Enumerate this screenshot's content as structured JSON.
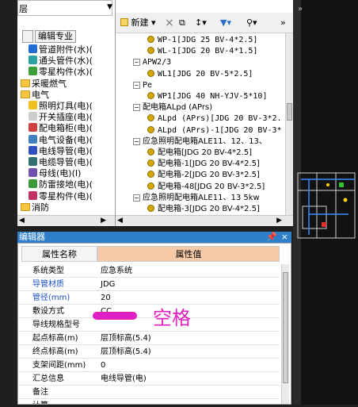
{
  "left_panel": {
    "filter_value": "层",
    "tabs": [
      "编辑专业"
    ],
    "tree": [
      {
        "label": "管道附件(水)(",
        "color": "#1e6cd6"
      },
      {
        "label": "通头管件(水)(",
        "color": "#2aa2a2"
      },
      {
        "label": "零星构件(水)(",
        "color": "#3aa03a"
      },
      {
        "label": "采暖燃气",
        "folder": true
      },
      {
        "label": "电气",
        "folder": true
      },
      {
        "label": "照明灯具(电)(",
        "color": "#f0c020"
      },
      {
        "label": "开关插座(电)(",
        "color": "#cccccc"
      },
      {
        "label": "配电箱柜(电)(",
        "color": "#d04040"
      },
      {
        "label": "电气设备(电)(",
        "color": "#4080c0"
      },
      {
        "label": "电线导管(电)(",
        "color": "#3050c0"
      },
      {
        "label": "电缆导管(电)(",
        "color": "#307070"
      },
      {
        "label": "母线(电)(I)",
        "color": "#7050b0"
      },
      {
        "label": "防雷接地(电)(",
        "color": "#3a9a3a"
      },
      {
        "label": "零星构件(电)(",
        "color": "#c03060"
      },
      {
        "label": "消防",
        "folder": true
      }
    ]
  },
  "right_panel": {
    "toolbar": {
      "new_label": "新建",
      "delete_icon": "×"
    },
    "rows": [
      {
        "text": "WP-1[JDG 25 BV-4*2.5]",
        "type": "leaf"
      },
      {
        "text": "WL-1[JDG 20 BV-4*1.5]",
        "type": "leaf"
      },
      {
        "text": "APW2/3",
        "type": "group"
      },
      {
        "text": "WL1[JDG 20 BV-5*2.5]",
        "type": "leaf"
      },
      {
        "text": "Pe",
        "type": "group"
      },
      {
        "text": "WP1[JDG 40 NH-YJV-5*10]",
        "type": "leaf"
      },
      {
        "text": "配电箱ALpd (APrs)",
        "type": "group"
      },
      {
        "text": "ALpd (APrs)[JDG 20 BV-3*2.",
        "type": "leaf"
      },
      {
        "text": "ALpd (APrs)-1[JDG 20 BV-3*",
        "type": "leaf"
      },
      {
        "text": "应急照明配电箱ALE11、12、13、",
        "type": "group"
      },
      {
        "text": "配电箱[JDG 20 BV-4*2.5]",
        "type": "leaf"
      },
      {
        "text": "配电箱-1[JDG 20 BV-4*2.5]",
        "type": "leaf"
      },
      {
        "text": "配电箱-2[JDG 20 BV-3*2.5]",
        "type": "leaf"
      },
      {
        "text": "配电箱-48[JDG 20 BV-3*2.5]",
        "type": "leaf"
      },
      {
        "text": "应急照明配电箱ALE11、13 5kw",
        "type": "group"
      },
      {
        "text": "配电箱-3[JDG 20 BV-4*2.5]",
        "type": "leaf"
      }
    ]
  },
  "props": {
    "header": "编辑器",
    "col_name": "属性名称",
    "col_value": "属性值",
    "rows": [
      {
        "name": "系统类型",
        "value": "应急系统",
        "blue": false
      },
      {
        "name": "导管材质",
        "value": "JDG",
        "blue": true
      },
      {
        "name": "管径(mm)",
        "value": "20",
        "blue": true
      },
      {
        "name": "敷设方式",
        "value": "CC",
        "blue": false
      },
      {
        "name": "导线规格型号",
        "value": "",
        "blue": false
      },
      {
        "name": "起点标高(m)",
        "value": "层顶标高(5.4)",
        "blue": false
      },
      {
        "name": "终点标高(m)",
        "value": "层顶标高(5.4)",
        "blue": false
      },
      {
        "name": "支架间距(mm)",
        "value": "0",
        "blue": false
      },
      {
        "name": "汇总信息",
        "value": "电线导管(电)",
        "blue": false
      },
      {
        "name": "备注",
        "value": "",
        "blue": false
      },
      {
        "name": "计算",
        "value": "",
        "blue": false
      }
    ],
    "annotation": "空格",
    "annotation_color": "#e020c0"
  }
}
